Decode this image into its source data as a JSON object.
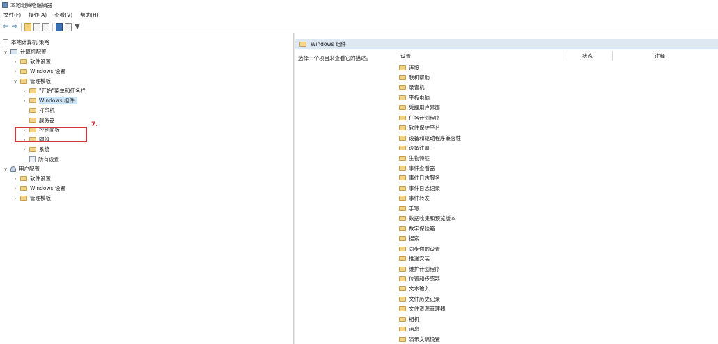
{
  "window": {
    "title": "本地组策略编辑器"
  },
  "menu": [
    "文件(F)",
    "操作(A)",
    "查看(V)",
    "帮助(H)"
  ],
  "toolbar": [
    {
      "name": "back-icon",
      "glyph": "⇦"
    },
    {
      "name": "forward-icon",
      "glyph": "⇨"
    }
  ],
  "tree": [
    {
      "label": "本地计算机 策略",
      "depth": 0,
      "toggle": "",
      "icon": "doc"
    },
    {
      "label": "计算机配置",
      "depth": 1,
      "toggle": "∨",
      "icon": "comp"
    },
    {
      "label": "软件设置",
      "depth": 2,
      "toggle": "›",
      "icon": "folder"
    },
    {
      "label": "Windows 设置",
      "depth": 2,
      "toggle": "›",
      "icon": "folder"
    },
    {
      "label": "管理模板",
      "depth": 2,
      "toggle": "∨",
      "icon": "folder"
    },
    {
      "label": "\"开始\"菜单和任务栏",
      "depth": 3,
      "toggle": "›",
      "icon": "folder"
    },
    {
      "label": "Windows 组件",
      "depth": 3,
      "toggle": "›",
      "icon": "folder",
      "selected": true
    },
    {
      "label": "打印机",
      "depth": 3,
      "toggle": "",
      "icon": "folder"
    },
    {
      "label": "服务器",
      "depth": 3,
      "toggle": "",
      "icon": "folder"
    },
    {
      "label": "控制面板",
      "depth": 3,
      "toggle": "›",
      "icon": "folder"
    },
    {
      "label": "网络",
      "depth": 3,
      "toggle": "›",
      "icon": "folder"
    },
    {
      "label": "系统",
      "depth": 3,
      "toggle": "›",
      "icon": "folder"
    },
    {
      "label": "所有设置",
      "depth": 3,
      "toggle": "",
      "icon": "settings"
    },
    {
      "label": "用户配置",
      "depth": 1,
      "toggle": "∨",
      "icon": "user"
    },
    {
      "label": "软件设置",
      "depth": 2,
      "toggle": "›",
      "icon": "folder"
    },
    {
      "label": "Windows 设置",
      "depth": 2,
      "toggle": "›",
      "icon": "folder"
    },
    {
      "label": "管理模板",
      "depth": 2,
      "toggle": "›",
      "icon": "folder"
    }
  ],
  "annotation": "7.",
  "right": {
    "header": "Windows 组件",
    "description": "选择一个项目来查看它的描述。",
    "columns": {
      "setting": "设置",
      "state": "状态",
      "comment": "注释"
    },
    "items": [
      "连接",
      "联机帮助",
      "录音机",
      "平板电脑",
      "凭据用户界面",
      "任务计划程序",
      "软件保护平台",
      "设备和驱动程序兼容性",
      "设备注册",
      "生物特征",
      "事件查看器",
      "事件日志服务",
      "事件日志记录",
      "事件转发",
      "手写",
      "数据收集和预览版本",
      "数字保险箱",
      "搜索",
      "同步你的设置",
      "推送安装",
      "维护计划程序",
      "位置和传感器",
      "文本输入",
      "文件历史记录",
      "文件资源管理器",
      "相机",
      "消息",
      "演示文稿设置"
    ]
  }
}
